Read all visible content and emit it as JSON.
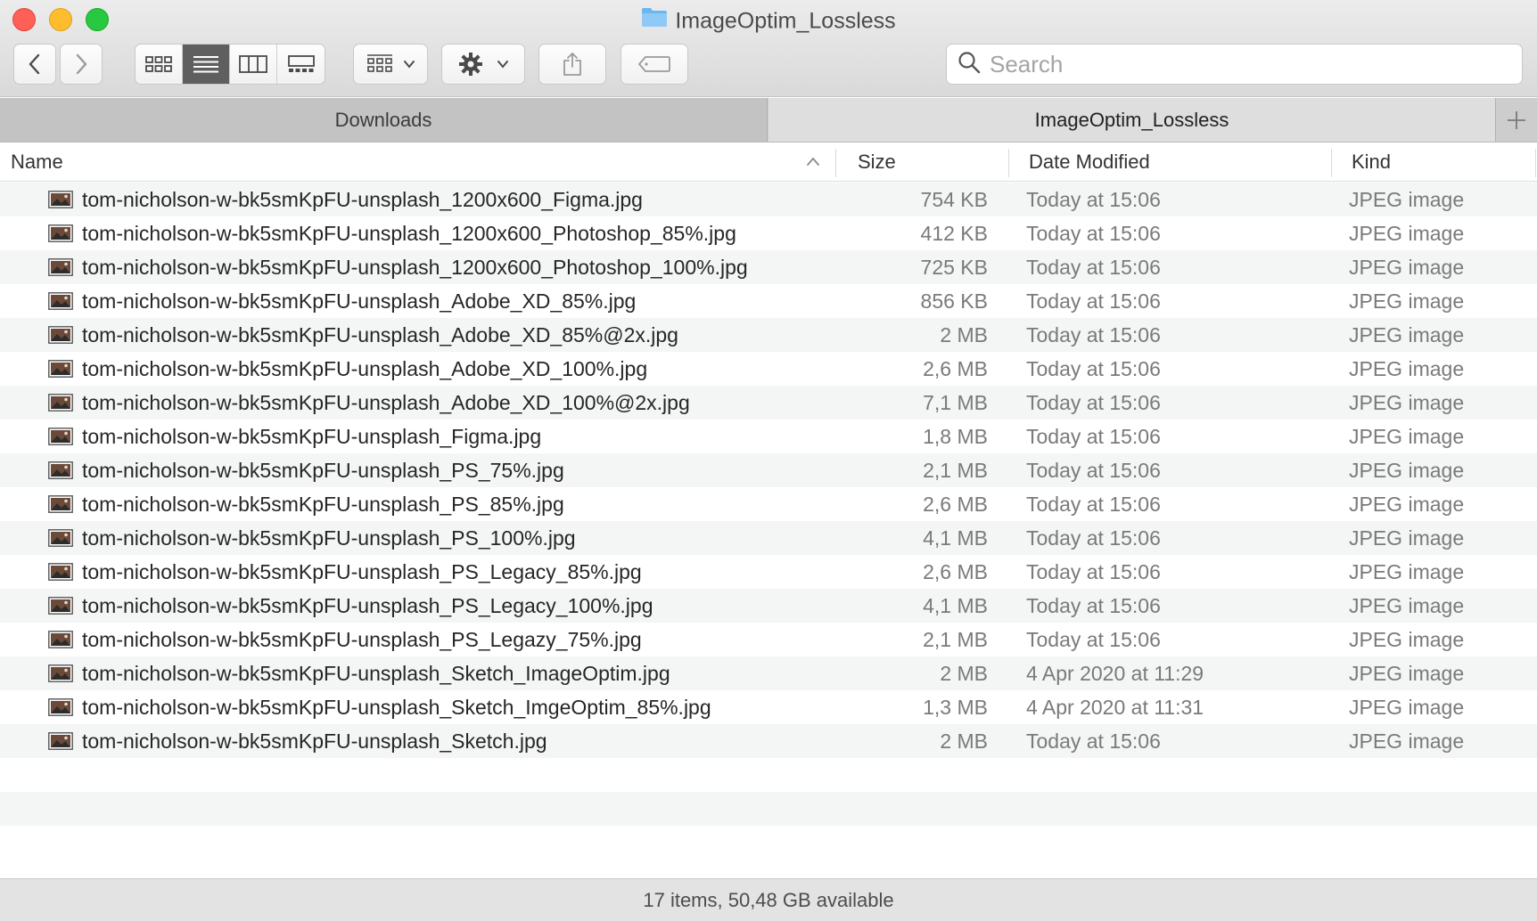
{
  "window": {
    "title": "ImageOptim_Lossless"
  },
  "toolbar": {
    "search_placeholder": "Search",
    "icons": [
      "chevron-left-icon",
      "chevron-right-icon",
      "icon-view-icon",
      "list-view-icon",
      "column-view-icon",
      "gallery-view-icon",
      "group-icon",
      "gear-icon",
      "share-icon",
      "tag-icon",
      "search-icon"
    ],
    "active_view": "list"
  },
  "tabs": [
    {
      "label": "Downloads",
      "active": false
    },
    {
      "label": "ImageOptim_Lossless",
      "active": true
    }
  ],
  "columns": {
    "name": "Name",
    "size": "Size",
    "date": "Date Modified",
    "kind": "Kind"
  },
  "files": [
    {
      "name": "tom-nicholson-w-bk5smKpFU-unsplash_1200x600_Figma.jpg",
      "size": "754 KB",
      "date": "Today at 15:06",
      "kind": "JPEG image"
    },
    {
      "name": "tom-nicholson-w-bk5smKpFU-unsplash_1200x600_Photoshop_85%.jpg",
      "size": "412 KB",
      "date": "Today at 15:06",
      "kind": "JPEG image"
    },
    {
      "name": "tom-nicholson-w-bk5smKpFU-unsplash_1200x600_Photoshop_100%.jpg",
      "size": "725 KB",
      "date": "Today at 15:06",
      "kind": "JPEG image"
    },
    {
      "name": "tom-nicholson-w-bk5smKpFU-unsplash_Adobe_XD_85%.jpg",
      "size": "856 KB",
      "date": "Today at 15:06",
      "kind": "JPEG image"
    },
    {
      "name": "tom-nicholson-w-bk5smKpFU-unsplash_Adobe_XD_85%@2x.jpg",
      "size": "2 MB",
      "date": "Today at 15:06",
      "kind": "JPEG image"
    },
    {
      "name": "tom-nicholson-w-bk5smKpFU-unsplash_Adobe_XD_100%.jpg",
      "size": "2,6 MB",
      "date": "Today at 15:06",
      "kind": "JPEG image"
    },
    {
      "name": "tom-nicholson-w-bk5smKpFU-unsplash_Adobe_XD_100%@2x.jpg",
      "size": "7,1 MB",
      "date": "Today at 15:06",
      "kind": "JPEG image"
    },
    {
      "name": "tom-nicholson-w-bk5smKpFU-unsplash_Figma.jpg",
      "size": "1,8 MB",
      "date": "Today at 15:06",
      "kind": "JPEG image"
    },
    {
      "name": "tom-nicholson-w-bk5smKpFU-unsplash_PS_75%.jpg",
      "size": "2,1 MB",
      "date": "Today at 15:06",
      "kind": "JPEG image"
    },
    {
      "name": "tom-nicholson-w-bk5smKpFU-unsplash_PS_85%.jpg",
      "size": "2,6 MB",
      "date": "Today at 15:06",
      "kind": "JPEG image"
    },
    {
      "name": "tom-nicholson-w-bk5smKpFU-unsplash_PS_100%.jpg",
      "size": "4,1 MB",
      "date": "Today at 15:06",
      "kind": "JPEG image"
    },
    {
      "name": "tom-nicholson-w-bk5smKpFU-unsplash_PS_Legacy_85%.jpg",
      "size": "2,6 MB",
      "date": "Today at 15:06",
      "kind": "JPEG image"
    },
    {
      "name": "tom-nicholson-w-bk5smKpFU-unsplash_PS_Legacy_100%.jpg",
      "size": "4,1 MB",
      "date": "Today at 15:06",
      "kind": "JPEG image"
    },
    {
      "name": "tom-nicholson-w-bk5smKpFU-unsplash_PS_Legazy_75%.jpg",
      "size": "2,1 MB",
      "date": "Today at 15:06",
      "kind": "JPEG image"
    },
    {
      "name": "tom-nicholson-w-bk5smKpFU-unsplash_Sketch_ImageOptim.jpg",
      "size": "2 MB",
      "date": "4 Apr 2020 at 11:29",
      "kind": "JPEG image"
    },
    {
      "name": "tom-nicholson-w-bk5smKpFU-unsplash_Sketch_ImgeOptim_85%.jpg",
      "size": "1,3 MB",
      "date": "4 Apr 2020 at 11:31",
      "kind": "JPEG image"
    },
    {
      "name": "tom-nicholson-w-bk5smKpFU-unsplash_Sketch.jpg",
      "size": "2 MB",
      "date": "Today at 15:06",
      "kind": "JPEG image"
    }
  ],
  "status": {
    "text": "17 items, 50,48 GB available"
  },
  "colors": {
    "stripe": "#f4f5f5",
    "active_view": "#5f5f5f",
    "close": "#fe5f57",
    "minimize": "#febc2e",
    "zoom": "#28c840"
  }
}
